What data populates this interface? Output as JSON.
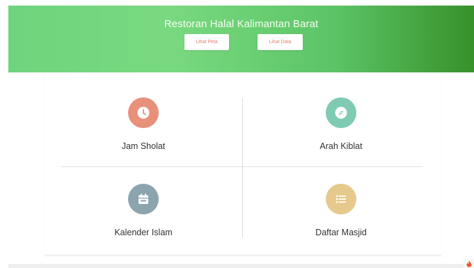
{
  "header": {
    "title": "Restoran Halal Kalimantan Barat",
    "buttons": {
      "peta_label": "Lihat Peta",
      "data_label": "Lihat Data"
    }
  },
  "menu": [
    {
      "label": "Jam Sholat",
      "icon": "clock-icon",
      "color": "#e8907a"
    },
    {
      "label": "Arah Kiblat",
      "icon": "compass-icon",
      "color": "#7fcab3"
    },
    {
      "label": "Kalender Islam",
      "icon": "calendar-icon",
      "color": "#8ca4ad"
    },
    {
      "label": "Daftar Masjid",
      "icon": "list-icon",
      "color": "#e6c98d"
    }
  ],
  "colors": {
    "header_start": "#6fd47e",
    "header_end": "#37912a",
    "button_text": "#e2826c"
  }
}
